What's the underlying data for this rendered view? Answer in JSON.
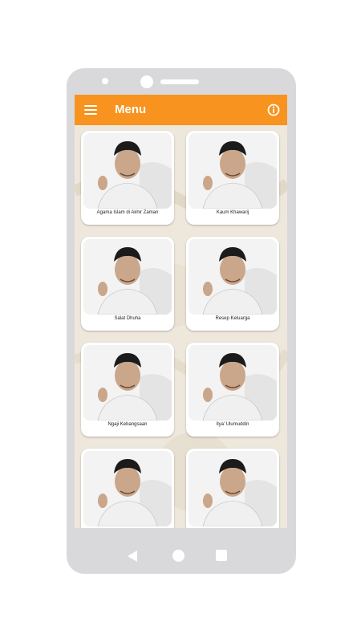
{
  "appbar": {
    "title": "Menu",
    "menu_icon": "hamburger-icon",
    "info_icon": "info-icon",
    "color": "#f7931e"
  },
  "menu_items": [
    {
      "label": "Agama Islam di Akhir Zaman"
    },
    {
      "label": "Kaum Khawarij"
    },
    {
      "label": "Salat Dhuha"
    },
    {
      "label": "Resep Keluarga"
    },
    {
      "label": "Ngaji Kebangsaan"
    },
    {
      "label": "Ilya' Ulumuddin"
    },
    {
      "label": ""
    },
    {
      "label": ""
    }
  ],
  "navbar": {
    "back_icon": "back-triangle-icon",
    "home_icon": "home-circle-icon",
    "recent_icon": "recent-square-icon"
  }
}
